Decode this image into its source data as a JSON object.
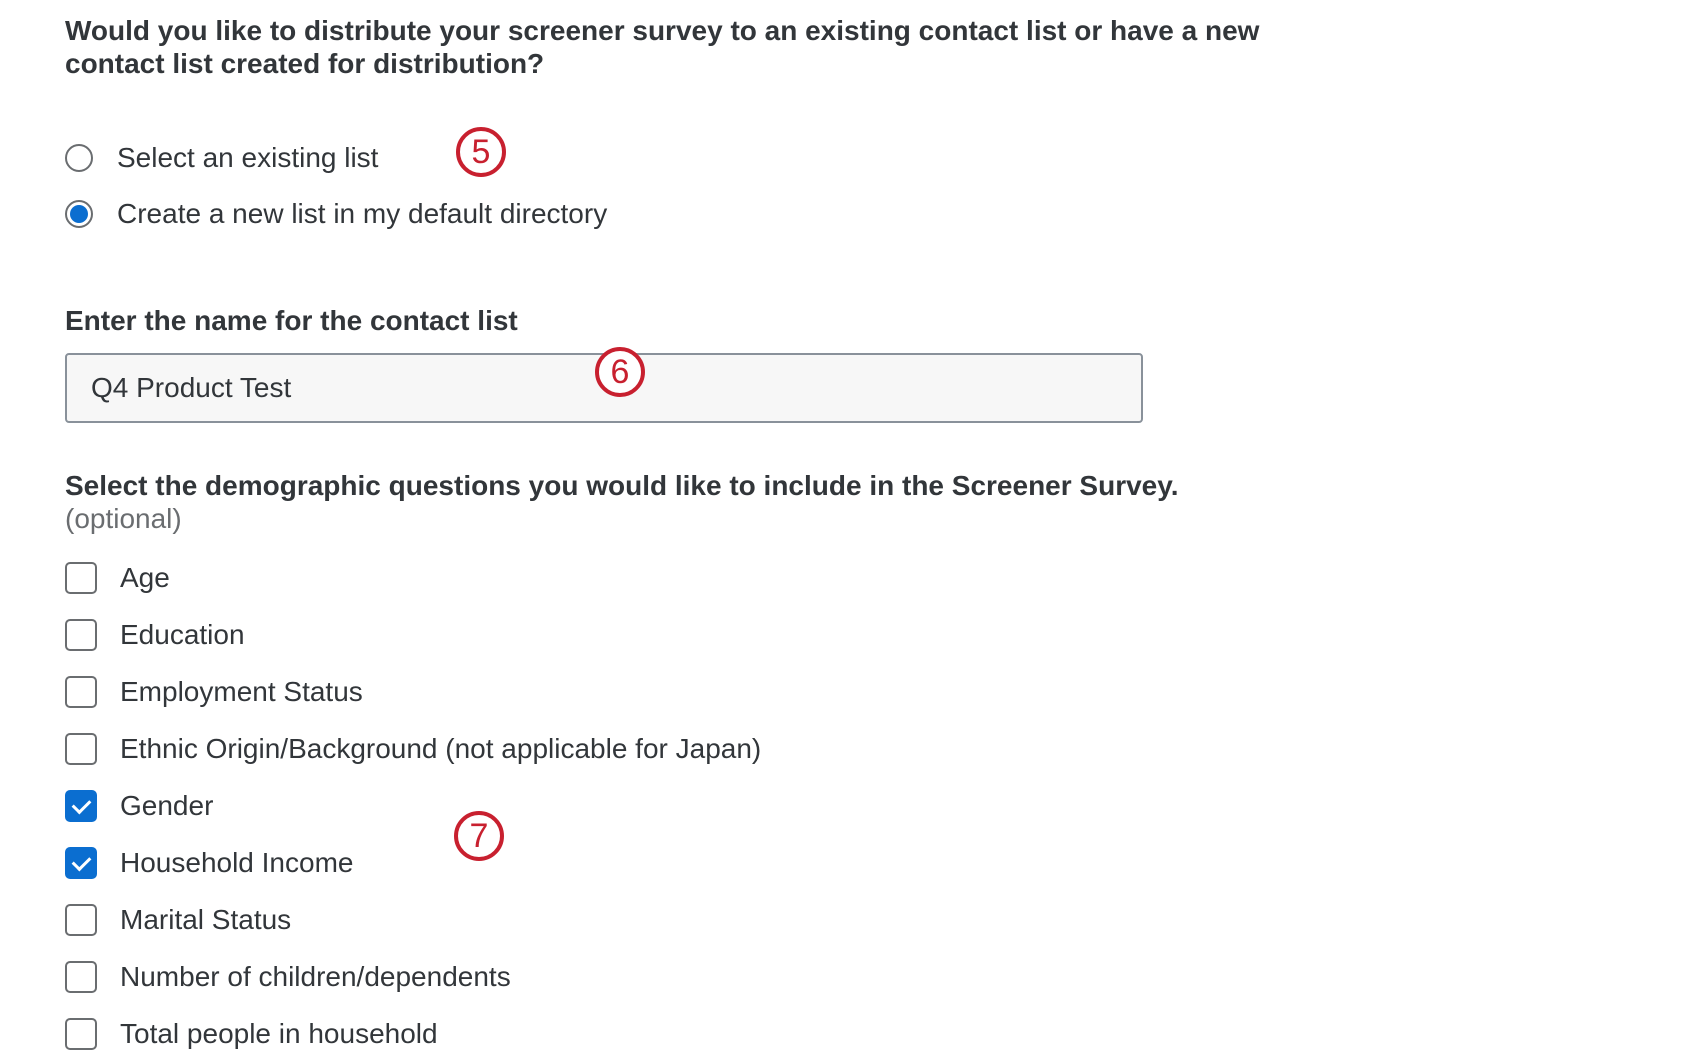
{
  "distribution": {
    "question": "Would you like to distribute your screener survey to an existing contact list or have a new contact list created for distribution?",
    "options": [
      {
        "label": "Select an existing list",
        "selected": false
      },
      {
        "label": "Create a new list in my default directory",
        "selected": true
      }
    ]
  },
  "contact_list": {
    "label": "Enter the name for the contact list",
    "value": "Q4 Product Test"
  },
  "demographics": {
    "heading": "Select the demographic questions you would like to include in the Screener Survey.",
    "optional_note": "(optional)",
    "items": [
      {
        "label": "Age",
        "checked": false
      },
      {
        "label": "Education",
        "checked": false
      },
      {
        "label": "Employment Status",
        "checked": false
      },
      {
        "label": "Ethnic Origin/Background (not applicable for Japan)",
        "checked": false
      },
      {
        "label": "Gender",
        "checked": true
      },
      {
        "label": "Household Income",
        "checked": true
      },
      {
        "label": "Marital Status",
        "checked": false
      },
      {
        "label": "Number of children/dependents",
        "checked": false
      },
      {
        "label": "Total people in household",
        "checked": false
      }
    ]
  },
  "annotations": {
    "marker_5": "5",
    "marker_6": "6",
    "marker_7": "7",
    "color": "#c8202f"
  },
  "colors": {
    "accent": "#0b6ed0",
    "text": "#32363a",
    "muted": "#6a6d70"
  }
}
